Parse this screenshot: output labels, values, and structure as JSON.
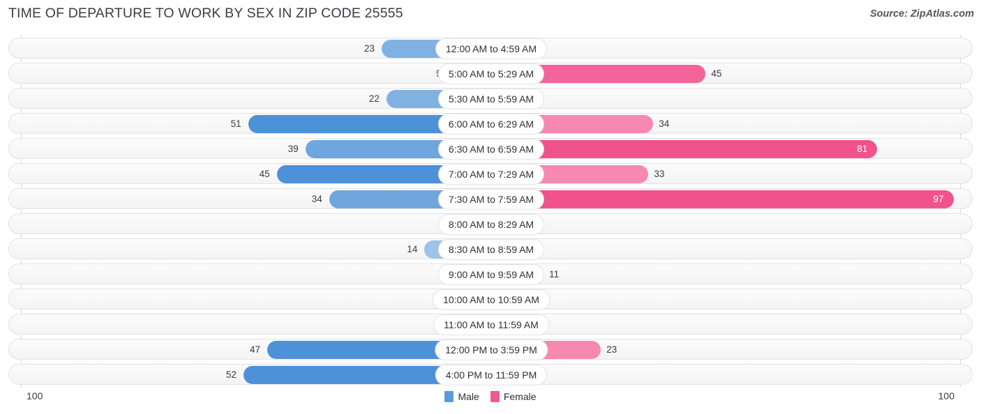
{
  "header": {
    "title": "TIME OF DEPARTURE TO WORK BY SEX IN ZIP CODE 25555",
    "source": "Source: ZipAtlas.com"
  },
  "legend": {
    "male_label": "Male",
    "female_label": "Female",
    "male_color": "#5b9bd5",
    "female_color": "#ef5a92"
  },
  "axis": {
    "left_max": "100",
    "right_max": "100"
  },
  "chart_data": {
    "type": "bar",
    "title": "TIME OF DEPARTURE TO WORK BY SEX IN ZIP CODE 25555",
    "subtitle": "Source: ZipAtlas.com",
    "orientation": "horizontal-diverging",
    "xlabel": "",
    "ylabel": "",
    "xlim": [
      100,
      100
    ],
    "grid": true,
    "legend_position": "bottom-center",
    "categories": [
      "12:00 AM to 4:59 AM",
      "5:00 AM to 5:29 AM",
      "5:30 AM to 5:59 AM",
      "6:00 AM to 6:29 AM",
      "6:30 AM to 6:59 AM",
      "7:00 AM to 7:29 AM",
      "7:30 AM to 7:59 AM",
      "8:00 AM to 8:29 AM",
      "8:30 AM to 8:59 AM",
      "9:00 AM to 9:59 AM",
      "10:00 AM to 10:59 AM",
      "11:00 AM to 11:59 AM",
      "12:00 PM to 3:59 PM",
      "4:00 PM to 11:59 PM"
    ],
    "series": [
      {
        "name": "Male",
        "color": "#5b9bd5",
        "side": "left",
        "values": [
          23,
          9,
          22,
          51,
          39,
          45,
          34,
          0,
          14,
          0,
          0,
          0,
          47,
          52
        ]
      },
      {
        "name": "Female",
        "color": "#ef5a92",
        "side": "right",
        "values": [
          0,
          45,
          0,
          34,
          81,
          33,
          97,
          0,
          0,
          11,
          0,
          0,
          23,
          0
        ]
      }
    ]
  }
}
